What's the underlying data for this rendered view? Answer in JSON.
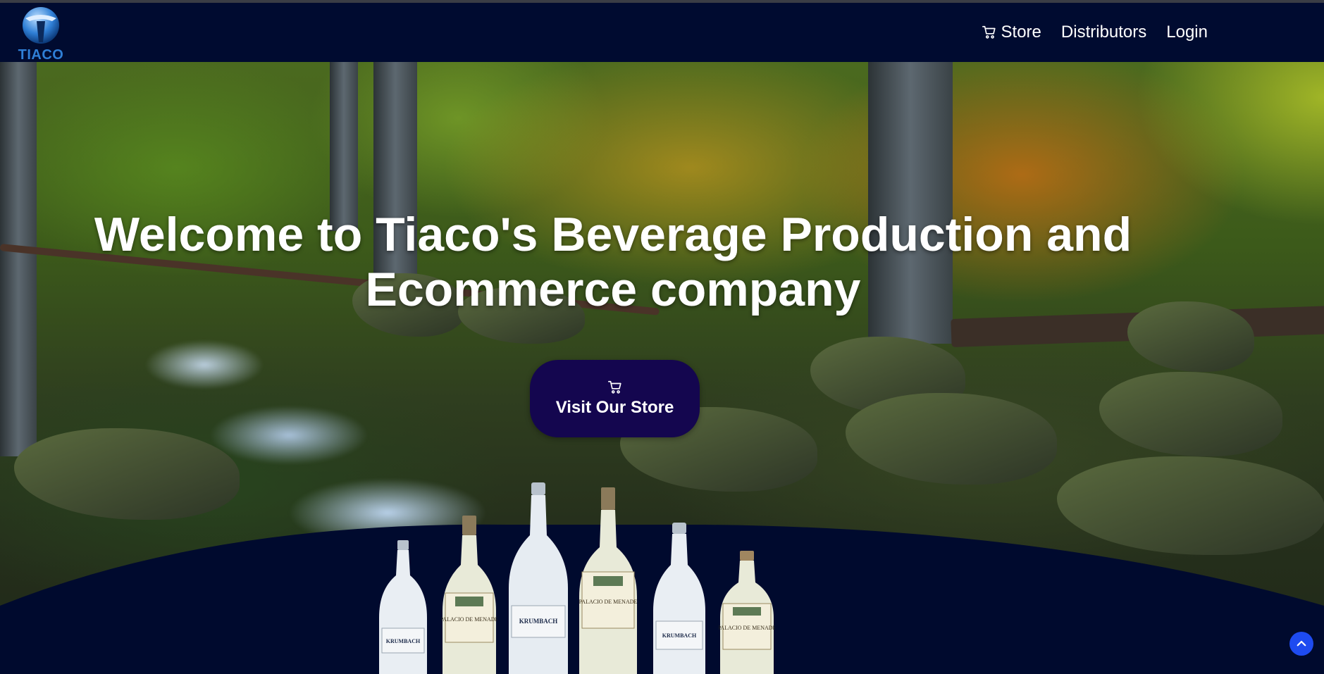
{
  "brand": {
    "name": "TIACO",
    "logo_icon": "tiaco-logo"
  },
  "nav": {
    "items": [
      {
        "label": "Store",
        "icon": "cart-icon"
      },
      {
        "label": "Distributors"
      },
      {
        "label": "Login"
      }
    ]
  },
  "hero": {
    "title": "Welcome to Tiaco's Beverage Production and Ecommerce company",
    "button": {
      "label": "Visit Our Store",
      "icon": "cart-icon"
    }
  },
  "bottles": [
    {
      "brand": "KRUMBACH",
      "kind": "water"
    },
    {
      "brand": "PALACIO DE MENADE",
      "kind": "wine"
    },
    {
      "brand": "KRUMBACH",
      "kind": "water"
    },
    {
      "brand": "PALACIO DE MENADE",
      "kind": "wine"
    },
    {
      "brand": "KRUMBACH",
      "kind": "water"
    },
    {
      "brand": "PALACIO DE MENADE",
      "kind": "wine"
    }
  ],
  "colors": {
    "navbar": "#000b30",
    "button": "#14064f",
    "scroll_top": "#1e4bf0",
    "logo_blue": "#2f7fd6"
  },
  "scroll_top": {
    "icon": "chevron-up-icon"
  }
}
